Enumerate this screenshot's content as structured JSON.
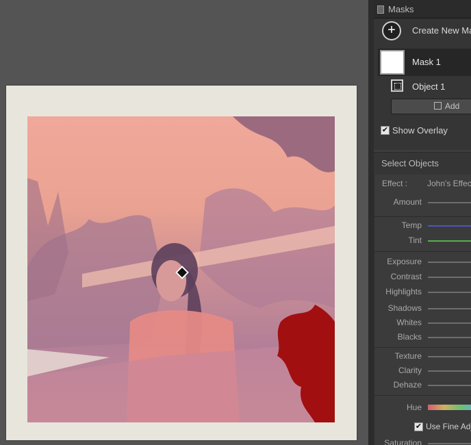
{
  "masks_panel": {
    "title": "Masks",
    "create_label": "Create New Mask",
    "create_symbol": "+",
    "mask_name": "Mask 1",
    "object_name": "Object 1",
    "add_label": "Add",
    "show_overlay_label": "Show Overlay",
    "show_overlay_checked": true,
    "check_glyph": "✔"
  },
  "select_objects": {
    "title": "Select Objects"
  },
  "adjustments": {
    "effect_label": "Effect :",
    "effect_value": "John's Effects",
    "sliders": {
      "amount": "Amount",
      "temp": "Temp",
      "tint": "Tint",
      "exposure": "Exposure",
      "contrast": "Contrast",
      "highlights": "Highlights",
      "shadows": "Shadows",
      "whites": "Whites",
      "blacks": "Blacks",
      "texture": "Texture",
      "clarity": "Clarity",
      "dehaze": "Dehaze",
      "hue": "Hue",
      "saturation": "Saturation"
    },
    "use_fine_label": "Use Fine Adjustment",
    "use_fine_checked": true
  },
  "colors": {
    "temp_track": "#4a56c8",
    "tint_track": "#58b050",
    "overlay_red": "#a10f10"
  }
}
